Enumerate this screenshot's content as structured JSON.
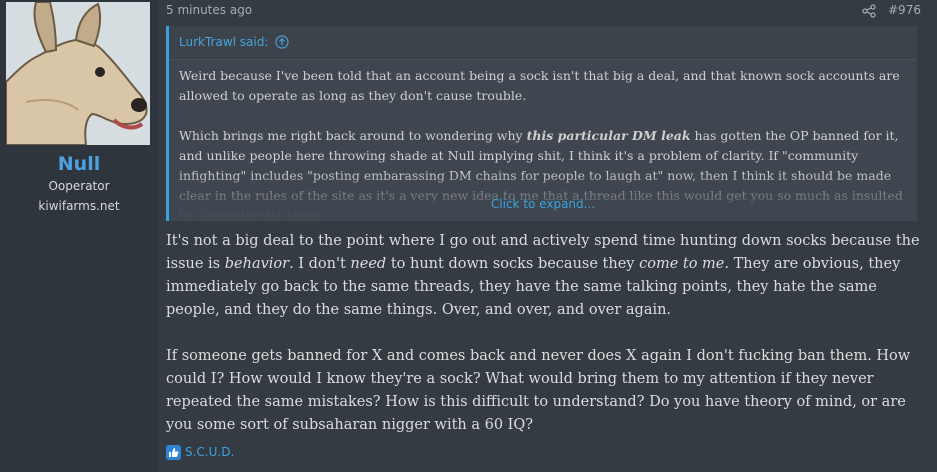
{
  "author": {
    "name": "Null",
    "title": "Ooperator",
    "banner": "kiwifarms.net",
    "avatar_icon": "dog-avatar-icon"
  },
  "post": {
    "time": "5 minutes ago",
    "number": "#976",
    "quote": {
      "author": "LurkTrawl said:",
      "para1": "Weird because I've been told that an account being a sock isn't that big a deal, and that known sock accounts are allowed to operate as long as they don't cause trouble.",
      "para2_a": "Which brings me right back around to wondering why ",
      "para2_em": "this particular DM leak",
      "para2_b": " has gotten the OP banned for it, and unlike people here throwing shade at Null implying shit, I think it's a problem of clarity. If \"community infighting\" includes \"posting embarassing DM chains for people to laugh at\" now, then I think it should be made clear in the rules of the site as it's a very new idea to me that a thread like this would get you so much as insulted by a member let alone",
      "expand": "Click to expand..."
    },
    "body": {
      "p1_a": "It's not a big deal to the point where I go out and actively spend time hunting down socks because the issue is ",
      "p1_em1": "behavior",
      "p1_b": ". I don't ",
      "p1_em2": "need",
      "p1_c": " to hunt down socks because they ",
      "p1_em3": "come to me",
      "p1_d": ". They are obvious, they immediately go back to the same threads, they have the same talking points, they hate the same people, and they do the same things. Over, and over, and over again.",
      "p2": "If someone gets banned for X and comes back and never does X again I don't fucking ban them. How could I? How would I know they're a sock? What would bring them to my attention if they never repeated the same mistakes? How is this difficult to understand? Do you have theory of mind, or are you some sort of subsaharan nigger with a 60 IQ?"
    },
    "reactions": {
      "icon": "thumbs-up-icon",
      "names": "S.C.U.D."
    }
  },
  "colors": {
    "accent": "#3aa3df",
    "background": "#353b43",
    "quote_bg": "#40464f"
  }
}
